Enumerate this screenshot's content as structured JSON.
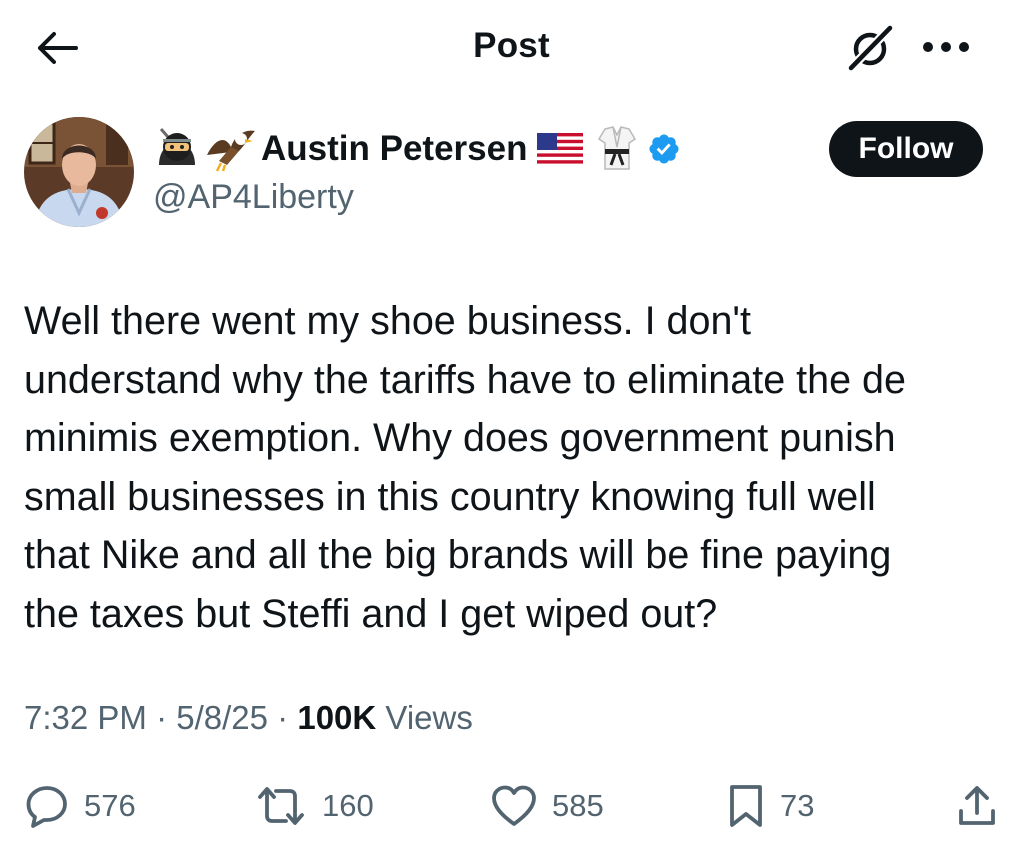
{
  "header": {
    "title": "Post",
    "icons": {
      "back": "arrow-left-icon",
      "grok": "grok-icon",
      "more": "more-horizontal-icon"
    }
  },
  "author": {
    "display_name": "Austin Petersen",
    "handle": "@AP4Liberty",
    "verified": true,
    "name_emojis_before": [
      "ninja-emoji",
      "eagle-emoji"
    ],
    "name_emojis_after": [
      "us-flag-emoji",
      "martial-arts-uniform-emoji",
      "verified-badge-icon"
    ],
    "follow_label": "Follow"
  },
  "post": {
    "lines": [
      "Well there went my shoe business. I don't",
      "understand why the tariffs have to eliminate the de",
      "minimis exemption. Why does government punish",
      "small businesses in this country knowing full well",
      "that Nike and all the big brands will be fine paying",
      "the taxes but Steffi and I get wiped out?"
    ],
    "time": "7:32 PM",
    "date": "5/8/25",
    "separator": "·",
    "views_count": "100K",
    "views_label": "Views"
  },
  "actions": {
    "replies": "576",
    "reposts": "160",
    "likes": "585",
    "bookmarks": "73"
  },
  "colors": {
    "text": "#0f1419",
    "muted": "#536471",
    "verified": "#1d9bf0",
    "follow_bg": "#0f1419",
    "background": "#ffffff"
  }
}
